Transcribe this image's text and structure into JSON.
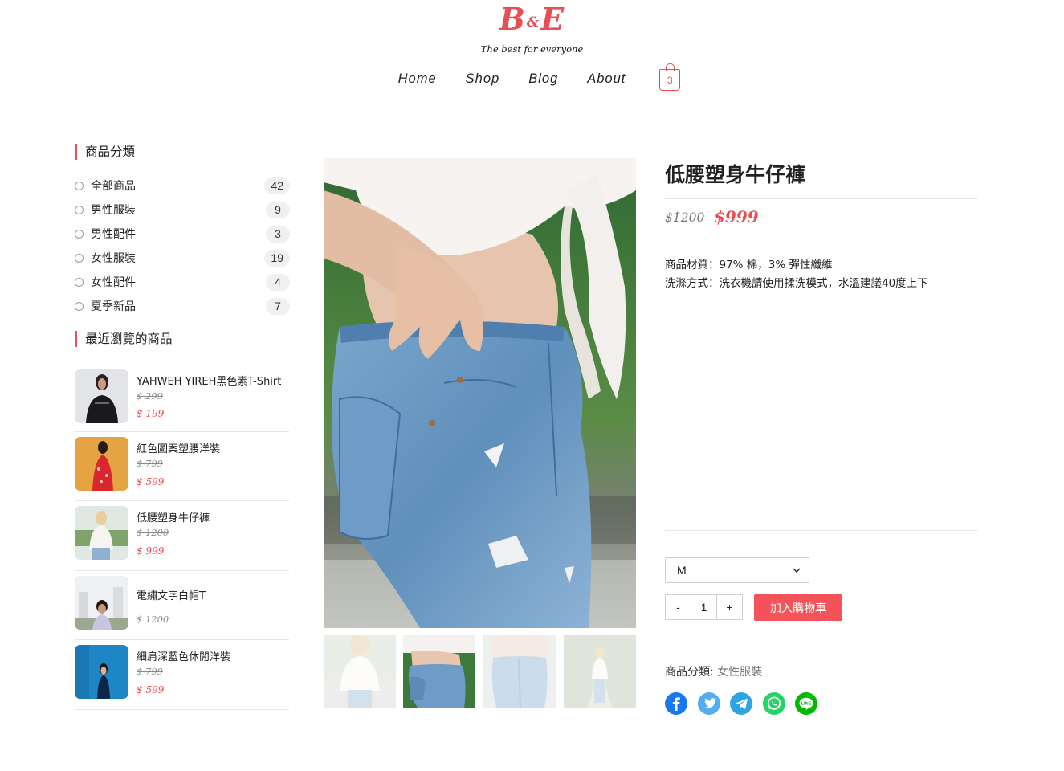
{
  "header": {
    "logo_letter_left": "B",
    "logo_amp": "&",
    "logo_letter_right": "E",
    "tagline": "The best for everyone",
    "nav": [
      "Home",
      "Shop",
      "Blog",
      "About"
    ],
    "cart_count": "3"
  },
  "sidebar": {
    "categories_title": "商品分類",
    "categories": [
      {
        "label": "全部商品",
        "count": "42"
      },
      {
        "label": "男性服裝",
        "count": "9"
      },
      {
        "label": "男性配件",
        "count": "3"
      },
      {
        "label": "女性服裝",
        "count": "19"
      },
      {
        "label": "女性配件",
        "count": "4"
      },
      {
        "label": "夏季新品",
        "count": "7"
      }
    ],
    "recent_title": "最近瀏覽的商品",
    "recent": [
      {
        "name": "YAHWEH YIREH黑色素T-Shirt",
        "old_price": "$ 299",
        "price": "$ 199"
      },
      {
        "name": "紅色圖案塑腰洋裝",
        "old_price": "$ 799",
        "price": "$ 599"
      },
      {
        "name": "低腰塑身牛仔褲",
        "old_price": "$ 1200",
        "price": "$ 999"
      },
      {
        "name": "電繡文字白帽T",
        "price_only": "$ 1200"
      },
      {
        "name": "細肩深藍色休閒洋裝",
        "old_price": "$ 799",
        "price": "$ 599"
      }
    ]
  },
  "product": {
    "title": "低腰塑身牛仔褲",
    "old_price": "$1200",
    "price": "$999",
    "desc_lines": [
      "商品材質：97% 棉，3% 彈性纖維",
      "洗滌方式：洗衣機請使用揉洗模式，水溫建議40度上下"
    ],
    "size": "M",
    "qty_minus": "-",
    "qty_value": "1",
    "qty_plus": "+",
    "add_to_cart": "加入購物車",
    "category_label": "商品分類:",
    "category_value": "女性服裝",
    "share_icons": [
      "facebook-icon",
      "twitter-icon",
      "telegram-icon",
      "whatsapp-icon",
      "line-icon"
    ]
  },
  "colors": {
    "accent": "#e94e55",
    "button": "#f4535a",
    "facebook": "#1877f2",
    "twitter": "#55acee",
    "telegram": "#2ca5e0",
    "whatsapp": "#25d366",
    "line": "#00b900"
  }
}
